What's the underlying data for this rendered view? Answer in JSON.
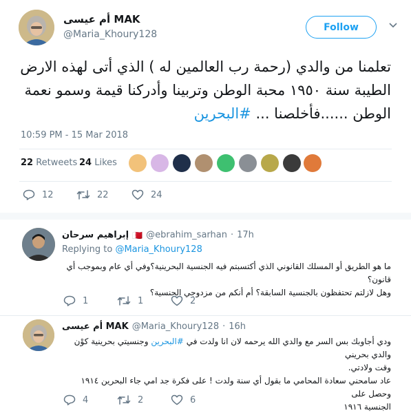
{
  "main_tweet": {
    "display_name": "أم عيسى MAK",
    "handle": "@Maria_Khoury128",
    "follow_label": "Follow",
    "text_lines": [
      "تعلمنا من والدي (رحمة رب العالمين له ) الذي أتى لهذه الارض",
      "الطيبة سنة ١٩٥٠ محبة الوطن وتربينا وأدركنا قيمة وسمو نعمة",
      "الوطن ......فأخلصنا ..."
    ],
    "hashtag": "#البحرين",
    "timestamp": "10:59 PM - 15 Mar 2018",
    "retweets_count": "22",
    "retweets_label": "Retweets",
    "likes_count": "24",
    "likes_label": "Likes",
    "actions": {
      "reply": "12",
      "retweet": "22",
      "like": "24"
    }
  },
  "replies": [
    {
      "display_name": "إبراهيم سرحان",
      "flag": "🇧🇭",
      "handle": "@ebrahim_sarhan",
      "time": "17h",
      "replying_to_label": "Replying to",
      "replying_to_handle": "@Maria_Khoury128",
      "text_lines": [
        "ما هو الطريق أو المسلك القانوني الذي أكتسبتم فيه الجنسية البحرينية؟وفي أي عام وبموجب أي قانون؟",
        "وهل لازلتم تحتفظون بالجنسية السابقة؟ أم أنكم من مزدوجي الجنسية؟"
      ],
      "actions": {
        "reply": "1",
        "retweet": "1",
        "like": "2"
      }
    },
    {
      "display_name": "أم عيسى MAK",
      "handle": "@Maria_Khoury128",
      "time": "16h",
      "text_line1_pre": "ودي  أجاوبك بس السر مع والدي الله يرحمه لان انا ولدت في",
      "text_line1_hashtag": "#البحرين",
      "text_line1_post": "وجنسيتي بحرينية كوْن والدي بحريني",
      "text_lines_rest": [
        "وقت ولادتي.",
        "عاد سامحني سعادة المحامي ما بقول أي سنة ولدت ! على فكرة جد امي جاء البحرين ١٩١٤ وحصل على",
        "الجنسية ١٩١٦"
      ],
      "actions": {
        "reply": "4",
        "retweet": "2",
        "like": "6"
      }
    }
  ],
  "colors": {
    "accent": "#1da1f2",
    "link": "#1b95e0",
    "muted": "#657786",
    "divider": "#e6ecf0"
  }
}
